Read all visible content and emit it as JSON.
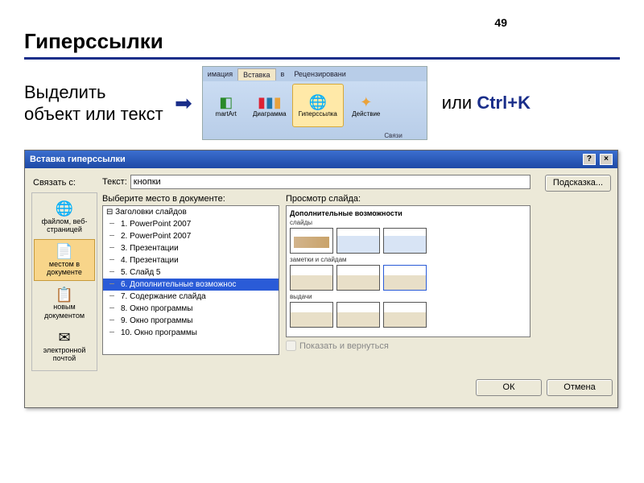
{
  "page_number": "49",
  "heading": "Гиперссылки",
  "step1_text": "Выделить объект или текст",
  "or_text": "или ",
  "shortcut": "Ctrl+K",
  "ribbon": {
    "tabs": [
      "имация",
      "Вставка",
      "в",
      "Рецензировани"
    ],
    "active_tab_index": 1,
    "buttons": [
      {
        "label": "martArt",
        "icon": "▣"
      },
      {
        "label": "Диаграмма",
        "icon": "▇"
      },
      {
        "label": "Гиперссылка",
        "icon": "🌐",
        "highlight": true
      },
      {
        "label": "Действие",
        "icon": "✦"
      }
    ],
    "group": "Связи"
  },
  "dialog": {
    "title": "Вставка гиперссылки",
    "link_with_label": "Связать с:",
    "link_targets": [
      {
        "icon": "🌐",
        "label": "файлом, веб-\nстраницей"
      },
      {
        "icon": "📄",
        "label": "местом в\nдокументе",
        "selected": true
      },
      {
        "icon": "📋",
        "label": "новым\nдокументом"
      },
      {
        "icon": "✉",
        "label": "электронной\nпочтой"
      }
    ],
    "text_label": "Текст:",
    "text_value": "кнопки",
    "hint_button": "Подсказка...",
    "place_label": "Выберите место в документе:",
    "tree_header": "Заголовки слайдов",
    "tree_items": [
      "1. PowerPoint 2007",
      "2. PowerPoint 2007",
      "3. Презентации",
      "4. Презентации",
      "5. Слайд 5",
      "6. Дополнительные возможнос",
      "7. Содержание слайда",
      "8. Окно программы",
      "9. Окно программы",
      "10. Окно программы"
    ],
    "tree_selected_index": 5,
    "preview_label": "Просмотр слайда:",
    "preview_title": "Дополнительные возможности",
    "preview_sections": [
      "слайды",
      "заметки и слайдам",
      "выдачи"
    ],
    "show_return": "Показать и вернуться",
    "ok": "ОК",
    "cancel": "Отмена"
  }
}
